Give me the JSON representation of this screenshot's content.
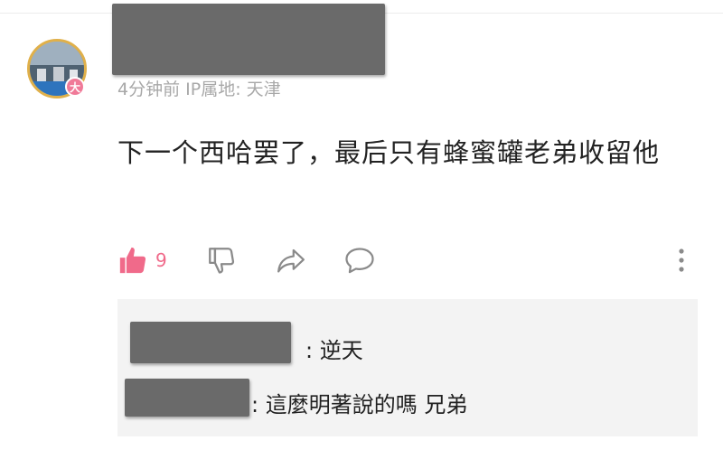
{
  "comment": {
    "meta": "4分钟前 IP属地: 天津",
    "avatar_badge": "大",
    "text": "下一个西哈罢了，最后只有蜂蜜罐老弟收留他",
    "like_count": "9",
    "icons": {
      "like": "thumbs-up-icon",
      "dislike": "thumbs-down-icon",
      "share": "share-icon",
      "reply": "comment-icon",
      "more": "more-vertical-icon"
    }
  },
  "replies": [
    {
      "text": ": 逆天"
    },
    {
      "text": ": 這麼明著說的嗎 兄弟"
    }
  ],
  "colors": {
    "accent_pink": "#f06a8a",
    "muted_text": "#a8a8a8",
    "icon_gray": "#8a8a8a",
    "reply_bg": "#f3f3f3"
  }
}
